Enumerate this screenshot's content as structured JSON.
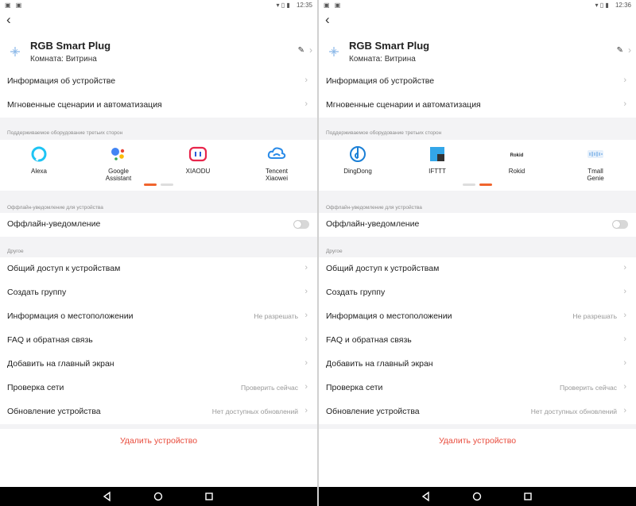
{
  "screens": [
    {
      "status": {
        "left_icons": "▣ ▣",
        "right_icons": "▾ ▯ ▮",
        "time": "12:35"
      },
      "device": {
        "name": "RGB Smart Plug",
        "room": "Комната: Витрина"
      },
      "rows_top": [
        {
          "label": "Информация об устройстве"
        },
        {
          "label": "Мгновенные сценарии и автоматизация"
        }
      ],
      "third_party": {
        "title": "Поддерживаемое оборудование третьих сторон",
        "items": [
          {
            "name": "Alexa",
            "icon": "alexa-icon",
            "color": "#1ec4f4"
          },
          {
            "name": "Google\nAssistant",
            "icon": "google-assistant-icon",
            "color": "#4285f4"
          },
          {
            "name": "XIAODU",
            "icon": "xiaodu-icon",
            "color": "#e8264c"
          },
          {
            "name": "Tencent\nXiaowei",
            "icon": "tencent-xiaowei-icon",
            "color": "#2a8be8"
          }
        ],
        "active_page": 0
      },
      "offline": {
        "section_title": "Оффлайн-уведомление для устройства",
        "label": "Оффлайн-уведомление",
        "enabled": false
      },
      "other": {
        "section_title": "Другое",
        "rows": [
          {
            "label": "Общий доступ к устройствам",
            "value": ""
          },
          {
            "label": "Создать группу",
            "value": ""
          },
          {
            "label": "Информация о местоположении",
            "value": "Не разрешать"
          },
          {
            "label": "FAQ и обратная связь",
            "value": ""
          },
          {
            "label": "Добавить на главный экран",
            "value": ""
          },
          {
            "label": "Проверка сети",
            "value": "Проверить сейчас"
          },
          {
            "label": "Обновление устройства",
            "value": "Нет доступных обновлений"
          }
        ]
      },
      "delete_label": "Удалить устройство"
    },
    {
      "status": {
        "left_icons": "▣ ▣",
        "right_icons": "▾ ▯ ▮",
        "time": "12:36"
      },
      "device": {
        "name": "RGB Smart Plug",
        "room": "Комната: Витрина"
      },
      "rows_top": [
        {
          "label": "Информация об устройстве"
        },
        {
          "label": "Мгновенные сценарии и автоматизация"
        }
      ],
      "third_party": {
        "title": "Поддерживаемое оборудование третьих сторон",
        "items": [
          {
            "name": "DingDong",
            "icon": "dingdong-icon",
            "color": "#1a7fd6"
          },
          {
            "name": "IFTTT",
            "icon": "ifttt-icon",
            "color": "#33a6e8"
          },
          {
            "name": "Rokid",
            "icon": "rokid-icon",
            "color": "#222222"
          },
          {
            "name": "Tmall\nGenie",
            "icon": "tmall-genie-icon",
            "color": "#7fb3e8"
          }
        ],
        "active_page": 1
      },
      "offline": {
        "section_title": "Оффлайн-уведомление для устройства",
        "label": "Оффлайн-уведомление",
        "enabled": false
      },
      "other": {
        "section_title": "Другое",
        "rows": [
          {
            "label": "Общий доступ к устройствам",
            "value": ""
          },
          {
            "label": "Создать группу",
            "value": ""
          },
          {
            "label": "Информация о местоположении",
            "value": "Не разрешать"
          },
          {
            "label": "FAQ и обратная связь",
            "value": ""
          },
          {
            "label": "Добавить на главный экран",
            "value": ""
          },
          {
            "label": "Проверка сети",
            "value": "Проверить сейчас"
          },
          {
            "label": "Обновление устройства",
            "value": "Нет доступных обновлений"
          }
        ]
      },
      "delete_label": "Удалить устройство"
    }
  ],
  "colors": {
    "accent": "#f0642d",
    "danger": "#e84b3c",
    "section_bg": "#f3f3f5"
  }
}
